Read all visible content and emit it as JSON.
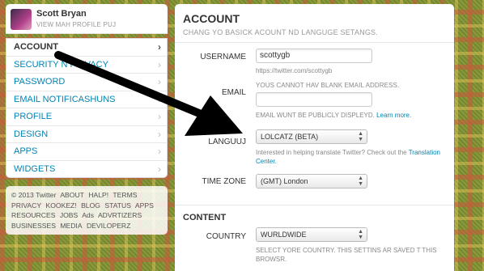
{
  "profile": {
    "name": "Scott Bryan",
    "link": "VIEW MAH PROFILE PUJ"
  },
  "nav": [
    {
      "label": "ACCOUNT",
      "active": true
    },
    {
      "label": "SECURITY N PRIVACY",
      "active": false
    },
    {
      "label": "PASSWORD",
      "active": false
    },
    {
      "label": "EMAIL NOTIFICASHUNS",
      "active": false
    },
    {
      "label": "PROFILE",
      "active": false
    },
    {
      "label": "DESIGN",
      "active": false
    },
    {
      "label": "APPS",
      "active": false
    },
    {
      "label": "WIDGETS",
      "active": false
    }
  ],
  "footer": {
    "links": [
      "© 2013 Twitter",
      "ABOUT",
      "HALP!",
      "TERMS",
      "PRIVACY",
      "KOOKEZ!",
      "BLOG",
      "STATUS",
      "APPS",
      "RESOURCES",
      "JOBS",
      "Ads",
      "ADVRTIZERS",
      "BUSINESSES",
      "MEDIA",
      "DEVILOPERZ"
    ]
  },
  "account": {
    "title": "ACCOUNT",
    "subtitle": "CHANG YO BASICK ACOUNT ND LANGUGE SETANGS.",
    "username_label": "USERNAME",
    "username_value": "scottygb",
    "username_url": "https://twitter.com/scottygb",
    "email_label": "EMAIL",
    "email_error": "YOUS CANNOT HAV BLANK EMAIL ADDRESS.",
    "email_value": "",
    "email_note": "EMAIL WUNT BE PUBLICLY DISPLEYD.",
    "email_learn_more": "Learn more.",
    "language_label": "LANGUUJ",
    "language_value": "LOLCATZ (BETA)",
    "language_help": "Interested in helping translate Twitter? Check out the",
    "language_help_link": "Translation Center.",
    "timezone_label": "TIME ZONE",
    "timezone_value": "(GMT) London"
  },
  "content": {
    "title": "CONTENT",
    "country_label": "COUNTRY",
    "country_value": "WURLDWIDE",
    "country_help": "SELECT YORE COUNTRY. THIS SETTINS AR SAVED T THIS BROWSR."
  },
  "colors": {
    "link": "#0084b4",
    "arrow": "#000000"
  }
}
